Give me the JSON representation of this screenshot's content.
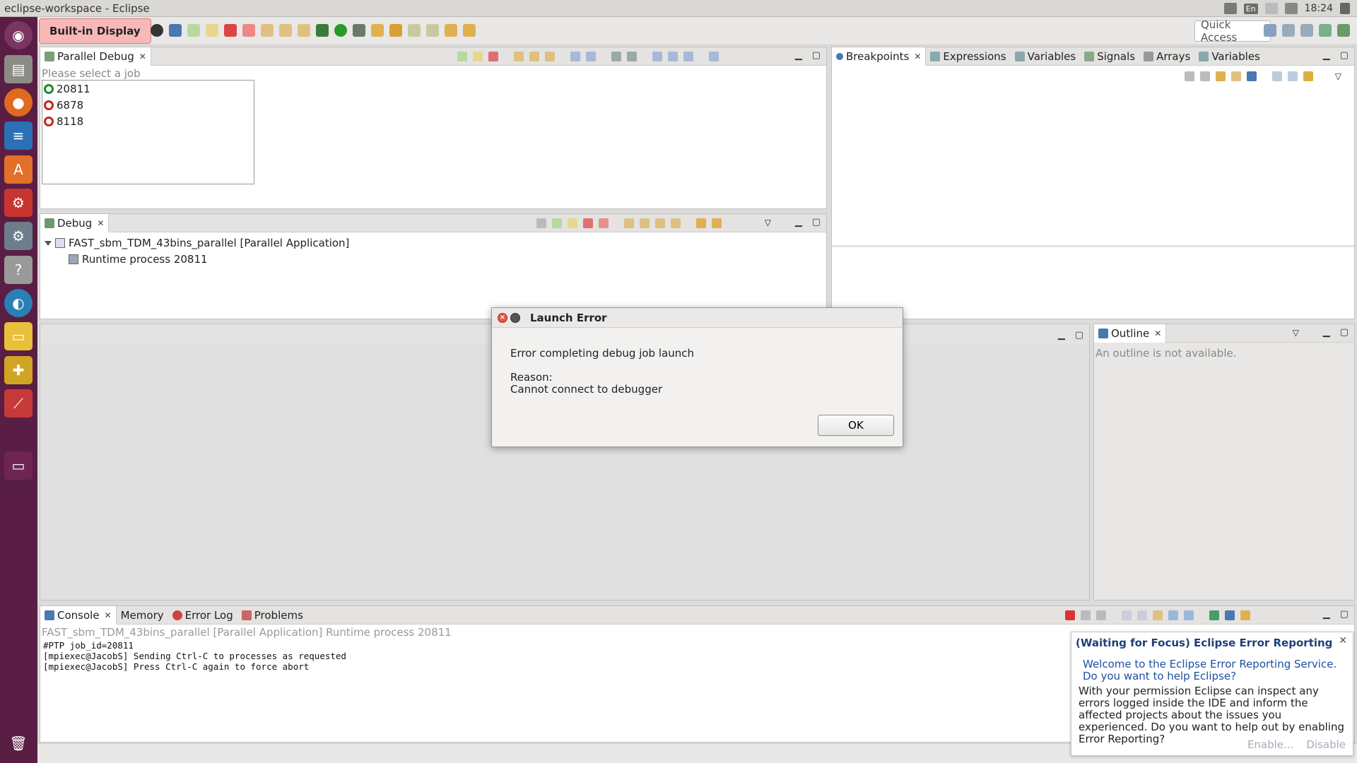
{
  "window": {
    "title": "eclipse-workspace - Eclipse"
  },
  "system_tray": {
    "lang": "En",
    "clock": "18:24"
  },
  "launcher": {
    "items": [
      "ubuntu-logo-icon",
      "files-icon",
      "firefox-icon",
      "writer-icon",
      "software-center-icon",
      "settings-icon",
      "system-settings-icon",
      "help-icon",
      "browser-icon",
      "display-icon",
      "puzzle-icon",
      "presentation-icon",
      "workspace-icon",
      "trash-icon"
    ]
  },
  "toolbar": {
    "builtin_display": "Built-in Display",
    "quick_access": "Quick Access"
  },
  "parallel_debug": {
    "tab": "Parallel Debug",
    "hint": "Please select a job",
    "jobs": [
      {
        "id": "20811",
        "status": "green"
      },
      {
        "id": "6878",
        "status": "red"
      },
      {
        "id": "8118",
        "status": "red"
      }
    ]
  },
  "right_top_panel": {
    "tabs": [
      "Breakpoints",
      "Expressions",
      "Variables",
      "Signals",
      "Arrays",
      "Variables"
    ]
  },
  "debug_panel": {
    "tab": "Debug",
    "tree": {
      "root": "FAST_sbm_TDM_43bins_parallel [Parallel Application]",
      "child": "Runtime process 20811"
    }
  },
  "outline": {
    "tab": "Outline",
    "message": "An outline is not available."
  },
  "console_panel": {
    "tabs": [
      "Console",
      "Memory",
      "Error Log",
      "Problems"
    ],
    "header": "FAST_sbm_TDM_43bins_parallel [Parallel Application] Runtime process 20811",
    "lines": [
      "#PTP job_id=20811",
      "[mpiexec@JacobS] Sending Ctrl-C to processes as requested",
      "[mpiexec@JacobS] Press Ctrl-C again to force abort"
    ]
  },
  "dialog": {
    "title": "Launch Error",
    "message": "Error completing debug job launch",
    "reason_label": "Reason:",
    "reason": "Cannot connect to debugger",
    "ok": "OK"
  },
  "notification": {
    "title": "(Waiting for Focus) Eclipse Error Reporting",
    "welcome_1": "Welcome to the Eclipse Error Reporting Service.",
    "welcome_2": "Do you want to help Eclipse?",
    "body": "With your permission Eclipse can inspect any errors logged inside the IDE and inform the affected projects about the issues you experienced. Do you want to help out by enabling Error Reporting?",
    "enable": "Enable...",
    "disable": "Disable"
  }
}
